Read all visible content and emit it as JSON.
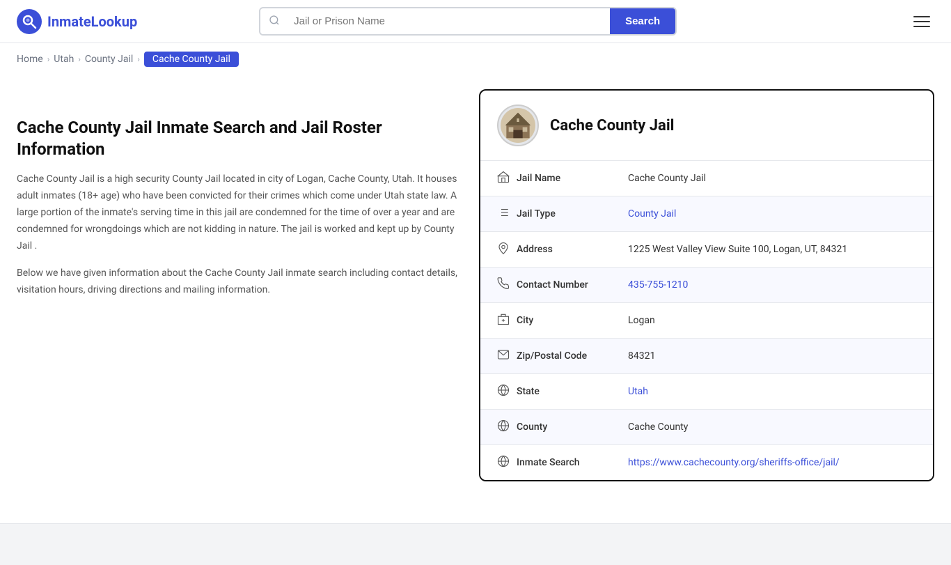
{
  "header": {
    "logo_text_part1": "Inmate",
    "logo_text_part2": "Lookup",
    "search_placeholder": "Jail or Prison Name",
    "search_button_label": "Search"
  },
  "breadcrumb": {
    "home": "Home",
    "state": "Utah",
    "category": "County Jail",
    "current": "Cache County Jail"
  },
  "left": {
    "page_title": "Cache County Jail Inmate Search and Jail Roster Information",
    "description1": "Cache County Jail is a high security County Jail located in city of Logan, Cache County, Utah. It houses adult inmates (18+ age) who have been convicted for their crimes which come under Utah state law. A large portion of the inmate's serving time in this jail are condemned for the time of over a year and are condemned for wrongdoings which are not kidding in nature. The jail is worked and kept up by County Jail .",
    "description2": "Below we have given information about the Cache County Jail inmate search including contact details, visitation hours, driving directions and mailing information."
  },
  "card": {
    "title": "Cache County Jail",
    "rows": [
      {
        "label": "Jail Name",
        "value": "Cache County Jail",
        "link": null,
        "icon": "jail-icon"
      },
      {
        "label": "Jail Type",
        "value": "County Jail",
        "link": "#",
        "icon": "list-icon"
      },
      {
        "label": "Address",
        "value": "1225 West Valley View Suite 100, Logan, UT, 84321",
        "link": null,
        "icon": "location-icon"
      },
      {
        "label": "Contact Number",
        "value": "435-755-1210",
        "link": "tel:435-755-1210",
        "icon": "phone-icon"
      },
      {
        "label": "City",
        "value": "Logan",
        "link": null,
        "icon": "city-icon"
      },
      {
        "label": "Zip/Postal Code",
        "value": "84321",
        "link": null,
        "icon": "mail-icon"
      },
      {
        "label": "State",
        "value": "Utah",
        "link": "#",
        "icon": "globe-icon"
      },
      {
        "label": "County",
        "value": "Cache County",
        "link": null,
        "icon": "county-icon"
      },
      {
        "label": "Inmate Search",
        "value": "https://www.cachecounty.org/sheriffs-office/jail/",
        "link": "https://www.cachecounty.org/sheriffs-office/jail/",
        "icon": "search-globe-icon"
      }
    ]
  }
}
